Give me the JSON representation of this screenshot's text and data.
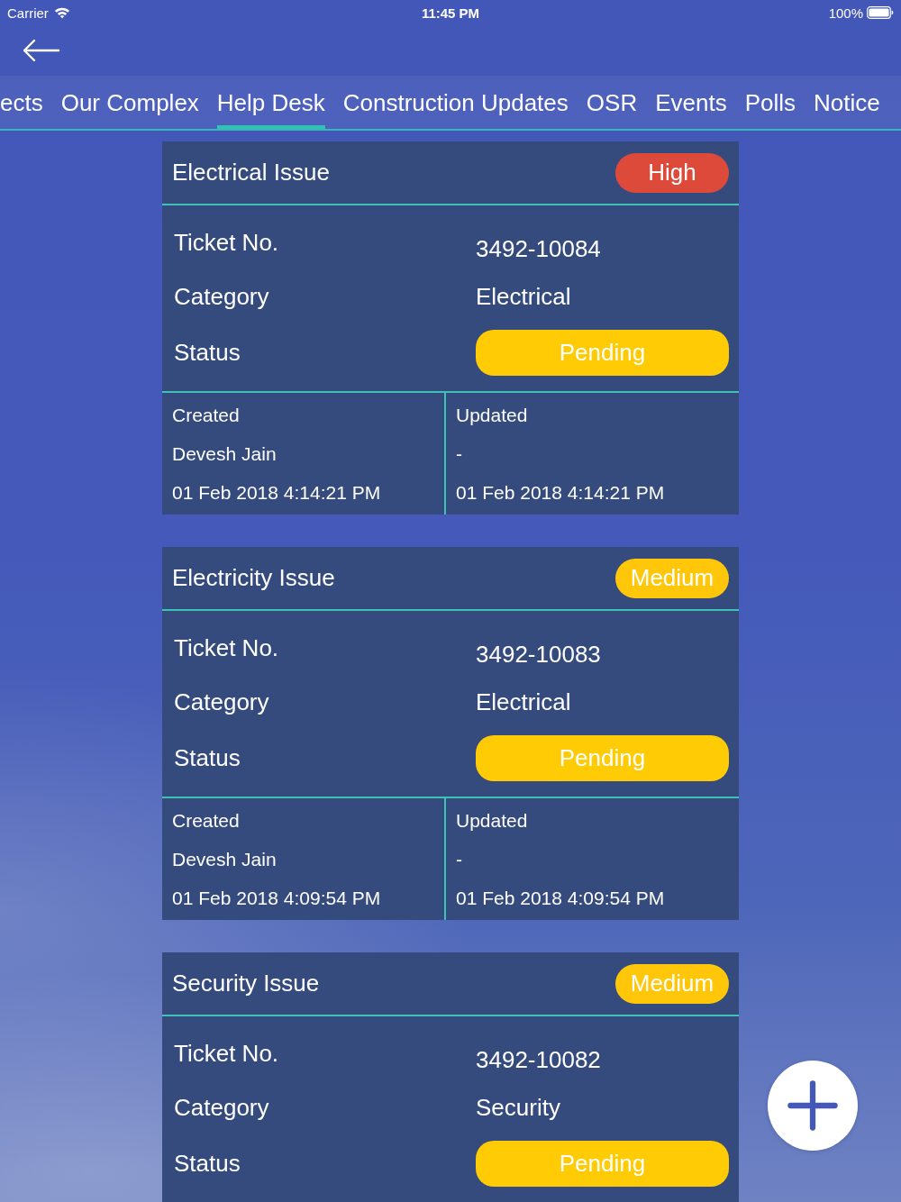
{
  "status_bar": {
    "carrier": "Carrier",
    "time": "11:45 PM",
    "battery": "100%"
  },
  "tabs": [
    {
      "label": "ects",
      "selected": false
    },
    {
      "label": "Our Complex",
      "selected": false
    },
    {
      "label": "Help Desk",
      "selected": true
    },
    {
      "label": "Construction Updates",
      "selected": false
    },
    {
      "label": "OSR",
      "selected": false
    },
    {
      "label": "Events",
      "selected": false
    },
    {
      "label": "Polls",
      "selected": false
    },
    {
      "label": "Notice",
      "selected": false
    }
  ],
  "tickets": [
    {
      "title": "Electrical Issue",
      "priority": {
        "label": "High",
        "color": "#dd4a3a"
      },
      "fields": [
        {
          "kind": "text",
          "label": "Ticket No.",
          "value": "3492-10084"
        },
        {
          "kind": "text",
          "label": "Category",
          "value": "Electrical"
        },
        {
          "kind": "pill",
          "label": "Status",
          "value": "Pending"
        }
      ],
      "created": {
        "heading": "Created",
        "by": "Devesh Jain",
        "date": "01 Feb 2018 4:14:21 PM"
      },
      "updated": {
        "heading": "Updated",
        "by": "-",
        "date": "01 Feb 2018 4:14:21 PM"
      }
    },
    {
      "title": "Electricity Issue",
      "priority": {
        "label": "Medium",
        "color": "#ffc60a"
      },
      "fields": [
        {
          "kind": "text",
          "label": "Ticket No.",
          "value": "3492-10083"
        },
        {
          "kind": "text",
          "label": "Category",
          "value": "Electrical"
        },
        {
          "kind": "pill",
          "label": "Status",
          "value": "Pending"
        }
      ],
      "created": {
        "heading": "Created",
        "by": "Devesh Jain",
        "date": "01 Feb 2018 4:09:54 PM"
      },
      "updated": {
        "heading": "Updated",
        "by": "-",
        "date": "01 Feb 2018 4:09:54 PM"
      }
    },
    {
      "title": "Security Issue",
      "priority": {
        "label": "Medium",
        "color": "#ffc60a"
      },
      "fields": [
        {
          "kind": "text",
          "label": "Ticket No.",
          "value": "3492-10082"
        },
        {
          "kind": "text",
          "label": "Category",
          "value": "Security"
        },
        {
          "kind": "pill",
          "label": "Status",
          "value": "Pending"
        }
      ]
    }
  ]
}
